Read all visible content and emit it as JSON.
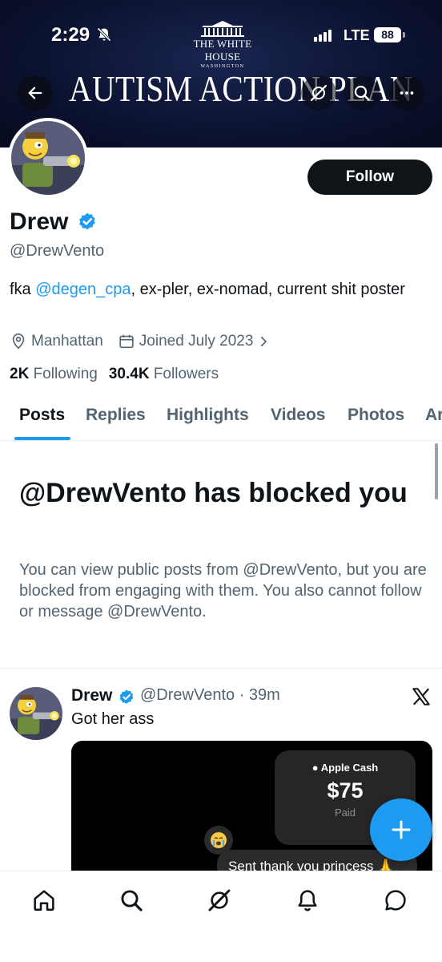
{
  "status_bar": {
    "time": "2:29",
    "network": "LTE",
    "battery": "88"
  },
  "banner": {
    "logo_name": "THE WHITE HOUSE",
    "logo_sub": "WASHINGTON",
    "title": "AUTISM ACTION PLAN"
  },
  "profile": {
    "follow_label": "Follow",
    "display_name": "Drew",
    "handle": "@DrewVento",
    "bio_prefix": "fka ",
    "bio_mention": "@degen_cpa",
    "bio_suffix": ", ex-pler, ex-nomad, current shit poster",
    "location": "Manhattan",
    "joined": "Joined July 2023",
    "following_count": "2K",
    "following_label": "Following",
    "followers_count": "30.4K",
    "followers_label": "Followers"
  },
  "tabs": [
    {
      "label": "Posts"
    },
    {
      "label": "Replies"
    },
    {
      "label": "Highlights"
    },
    {
      "label": "Videos"
    },
    {
      "label": "Photos"
    },
    {
      "label": "Articles"
    }
  ],
  "blocked": {
    "title": "@DrewVento has blocked you",
    "text": "You can view public posts from @DrewVento, but you are blocked from engaging with them. You also cannot follow or message @DrewVento."
  },
  "post": {
    "name": "Drew",
    "handle_time": "@DrewVento · 39m",
    "text": "Got her ass",
    "media": {
      "cash_label": "Apple Cash",
      "cash_amount": "$75",
      "cash_status": "Paid",
      "message": "Sent thank you princess 🙏"
    }
  },
  "colors": {
    "accent": "#1d9bf0",
    "text_primary": "#0f1419",
    "text_secondary": "#536471",
    "banner_bg": "#0c1430"
  },
  "icons": {
    "status": [
      "bell-off-icon",
      "signal-icon",
      "battery-icon"
    ],
    "header": [
      "back-arrow-icon",
      "grok-icon",
      "search-icon",
      "more-icon"
    ],
    "profile": [
      "verified-badge-icon",
      "location-icon",
      "calendar-icon",
      "chevron-right-icon"
    ],
    "post": [
      "x-logo-icon",
      "compose-plus-icon"
    ],
    "nav": [
      "home-icon",
      "search-icon",
      "grok-icon",
      "notifications-icon",
      "messages-icon"
    ]
  }
}
